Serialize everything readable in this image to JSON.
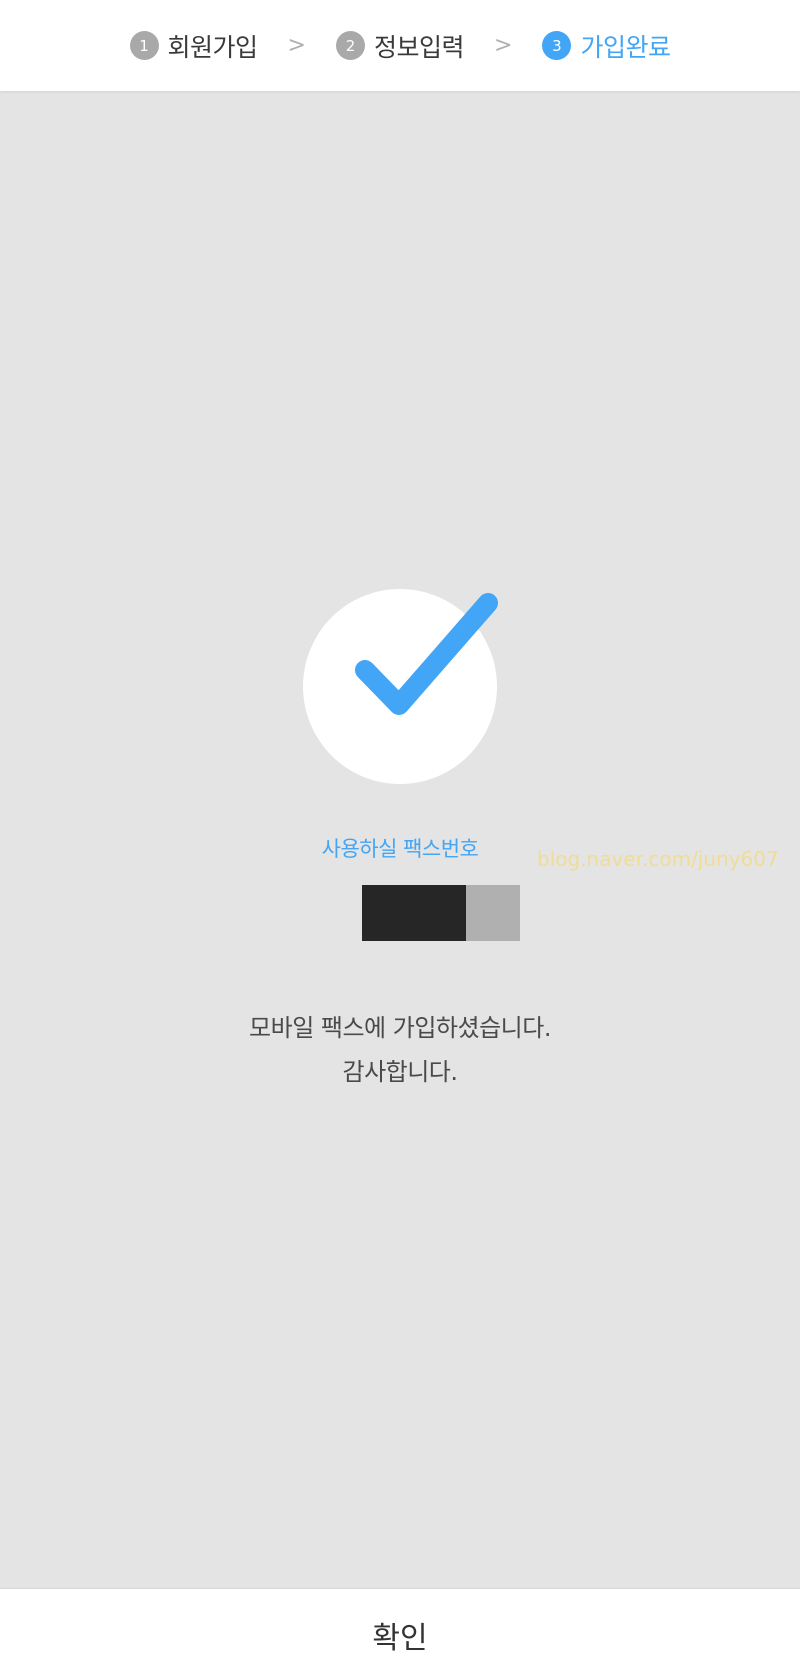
{
  "stepper": {
    "steps": [
      {
        "num": "1",
        "label": "회원가입",
        "state": "done"
      },
      {
        "num": "2",
        "label": "정보입력",
        "state": "done"
      },
      {
        "num": "3",
        "label": "가입완료",
        "state": "active"
      }
    ],
    "separator": ">"
  },
  "colors": {
    "accent": "#42a5f5",
    "background": "#e4e4e5",
    "step_inactive": "#a9a9a9"
  },
  "success_icon": "check-icon",
  "fax": {
    "label": "사용하실 팩스번호"
  },
  "watermark": "blog.naver.com/juny607",
  "message": {
    "line1": "모바일 팩스에 가입하셨습니다.",
    "line2": "감사합니다."
  },
  "footer": {
    "confirm_label": "확인"
  }
}
